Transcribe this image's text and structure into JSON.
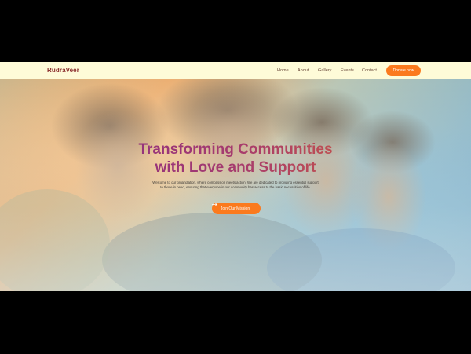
{
  "navbar": {
    "brand": "RudraVeer",
    "links": [
      "Home",
      "About",
      "Gallery",
      "Events",
      "Contact"
    ],
    "donate_label": "Donate now"
  },
  "hero": {
    "title_line1": "Transforming Communities",
    "title_line2": "with Love and Support",
    "description": "Welcome to our organization, where compassion meets action. We are dedicated to providing essential support to those in need, ensuring that everyone in our community has access to the basic necessities of life.",
    "cta_label": "Join Our Mission",
    "cta_icon": "arrow-right-icon"
  },
  "colors": {
    "nav_bg": "#fefbd8",
    "brand": "#8a2c2c",
    "accent": "#fb7a1e",
    "title_start": "#7d2a8f",
    "title_end": "#e06a2a"
  }
}
